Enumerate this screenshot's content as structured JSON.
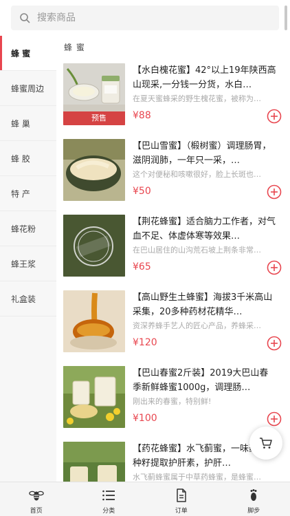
{
  "search": {
    "placeholder": "搜索商品"
  },
  "sidebar": {
    "items": [
      {
        "label": "蜂 蜜"
      },
      {
        "label": "蜂蜜周边"
      },
      {
        "label": "蜂 巢"
      },
      {
        "label": "蜂 胶"
      },
      {
        "label": "特 产"
      },
      {
        "label": "蜂花粉"
      },
      {
        "label": "蜂王浆"
      },
      {
        "label": "礼盒装"
      }
    ]
  },
  "main": {
    "category_title": "蜂 蜜",
    "products": [
      {
        "title": "【水白槐花蜜】42°以上19年陕西高山现采,一分钱一分货，水白…",
        "desc": "在夏天蜜蜂采的野生槐花蜜，被称为…",
        "price": "¥88",
        "badge": "预售"
      },
      {
        "title": "【巴山雪蜜】（椴树蜜）调理肠胃，滋阴润肺，一年只一采，…",
        "desc": "这个对便秘和咳嗽很好，脸上长斑也…",
        "price": "¥50"
      },
      {
        "title": "【荆花蜂蜜】适合脑力工作者，对气血不足、体虚体寒等效果…",
        "desc": "在巴山居住的山沟荒石坡上荆条非常…",
        "price": "¥65"
      },
      {
        "title": "【高山野生土蜂蜜】海拔3千米高山采集，20多种药材花精华…",
        "desc": "资深养蜂手艺人的匠心产品，养蜂采…",
        "price": "¥120"
      },
      {
        "title": "【巴山春蜜2斤装】2019大巴山春季新鲜蜂蜜1000g，调理肠…",
        "desc": "刚出来的春蜜，特别鲜!",
        "price": "¥100"
      },
      {
        "title": "【药花蜂蜜】水飞蓟蜜，一味药材，种籽提取护肝素，护肝…",
        "desc": "水飞蓟蜂蜜属于中草药蜂蜜，是蜂蜜…",
        "price": ""
      }
    ]
  },
  "tabbar": {
    "items": [
      {
        "label": "首页",
        "icon": "bee-icon"
      },
      {
        "label": "分类",
        "icon": "list-icon"
      },
      {
        "label": "订单",
        "icon": "document-icon"
      },
      {
        "label": "脚步",
        "icon": "footprint-icon"
      }
    ]
  },
  "colors": {
    "accent": "#e8464f",
    "sidebar_bg": "#f7f7f7",
    "tabbar_bg": "#f5f5f5"
  }
}
